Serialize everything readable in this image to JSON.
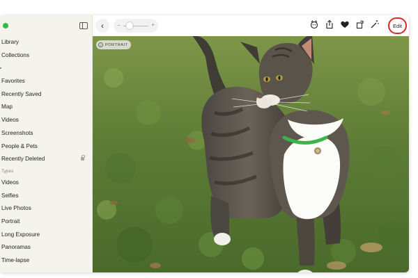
{
  "sidebar": {
    "items_top": [
      "Library",
      "Collections"
    ],
    "items_mid": [
      "Favorites",
      "Recently Saved",
      "Map",
      "Videos",
      "Screenshots",
      "People & Pets",
      "Recently Deleted"
    ],
    "section_types": "Types",
    "items_types": [
      "Videos",
      "Selfies",
      "Live Photos",
      "Portrait",
      "Long Exposure",
      "Panoramas",
      "Time-lapse"
    ]
  },
  "toolbar": {
    "back_glyph": "‹",
    "zoom_minus": "−",
    "zoom_plus": "+",
    "edit_label": "Edit",
    "zoom_level": 0.2
  },
  "photo": {
    "badge_label": "PORTRAIT",
    "badge_icon": "f"
  },
  "colors": {
    "accent_edit_ring": "#d42a1e",
    "window_green": "#2ebd42",
    "collar": "#3cb44a"
  }
}
